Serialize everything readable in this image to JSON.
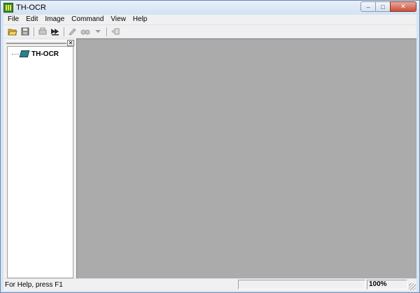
{
  "window": {
    "title": "TH-OCR"
  },
  "caption": {
    "minimize": "–",
    "maximize": "□",
    "close": "✕"
  },
  "menu": [
    "File",
    "Edit",
    "Image",
    "Command",
    "View",
    "Help"
  ],
  "toolbar": {
    "icons": [
      "open-folder-icon",
      "save-disk-icon",
      "scan-icon",
      "run-recognize-icon",
      "edit-icon",
      "glasses-icon",
      "dropdown-arrow-icon",
      "export-icon"
    ]
  },
  "pane": {
    "close_label": "✕"
  },
  "tree": {
    "root_label": "TH-OCR"
  },
  "status": {
    "help_text": "For Help, press F1",
    "zoom": "100%"
  },
  "colors": {
    "workspace": "#ababab",
    "title_bg": "#d6e4f5",
    "close_btn": "#c9503c"
  }
}
